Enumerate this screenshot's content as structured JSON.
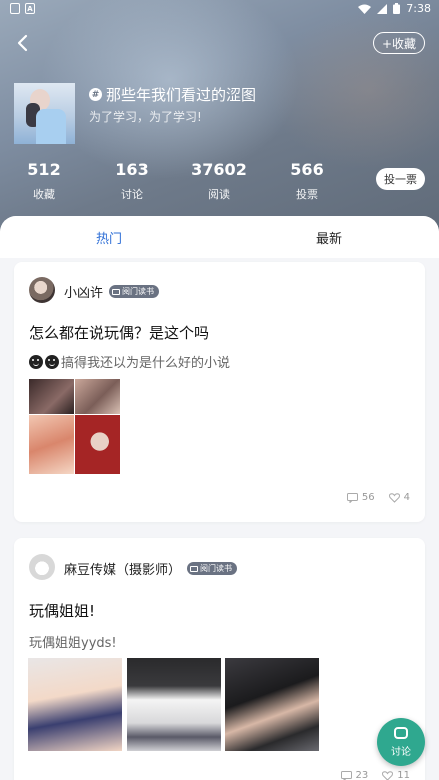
{
  "status_bar": {
    "time": "7:38"
  },
  "header": {
    "collect_label": "+收藏",
    "topic_title": "那些年我们看过的涩图",
    "topic_subtitle": "为了学习，为了学习!",
    "hash_symbol": "#"
  },
  "stats": [
    {
      "value": "512",
      "label": "收藏"
    },
    {
      "value": "163",
      "label": "讨论"
    },
    {
      "value": "37602",
      "label": "阅读"
    },
    {
      "value": "566",
      "label": "投票"
    }
  ],
  "vote_button": "投一票",
  "tabs": [
    {
      "label": "热门",
      "active": true
    },
    {
      "label": "最新",
      "active": false
    }
  ],
  "posts": [
    {
      "author": "小凶许",
      "badge": "阅门读书",
      "title": "怎么都在说玩偶？是这个吗",
      "body": "搞得我还以为是什么好的小说",
      "comments": "56",
      "likes": "4"
    },
    {
      "author": "麻豆传媒（摄影师）",
      "badge": "阅门读书",
      "title": "玩偶姐姐!",
      "body": "玩偶姐姐yyds!",
      "comments": "23",
      "likes": "11"
    }
  ],
  "fab": {
    "label": "讨论"
  },
  "colors": {
    "accent": "#2f6fd6",
    "fab": "#2fa88f"
  }
}
